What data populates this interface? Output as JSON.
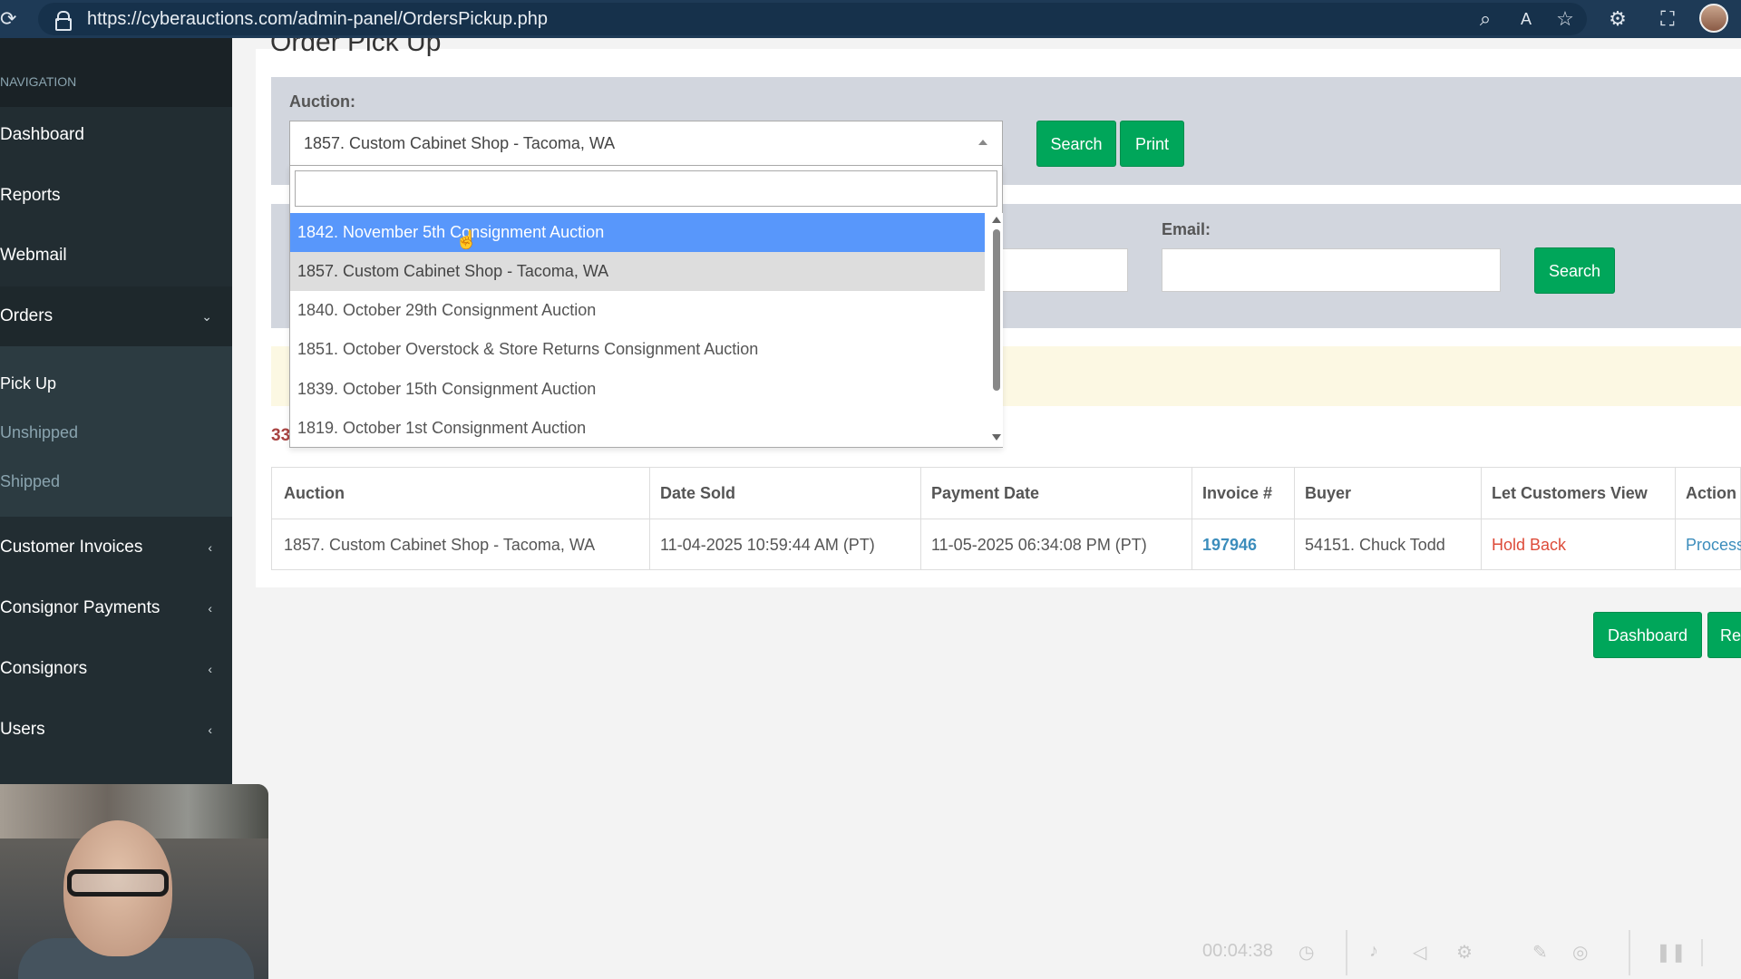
{
  "browser": {
    "url": "https://cyberauctions.com/admin-panel/OrdersPickup.php"
  },
  "sidebar": {
    "nav_header": "NAVIGATION",
    "items": [
      {
        "label": "Dashboard"
      },
      {
        "label": "Reports"
      },
      {
        "label": "Webmail"
      },
      {
        "label": "Orders"
      },
      {
        "label": "Customer Invoices"
      },
      {
        "label": "Consignor Payments"
      },
      {
        "label": "Consignors"
      },
      {
        "label": "Users"
      }
    ],
    "orders_sub": [
      {
        "label": "Pick Up",
        "active": true
      },
      {
        "label": "Unshipped"
      },
      {
        "label": "Shipped"
      }
    ]
  },
  "page": {
    "title": "Order Pick Up"
  },
  "auction_panel": {
    "label": "Auction:",
    "selected": "1857. Custom Cabinet Shop - Tacoma, WA",
    "search_button": "Search",
    "print_button": "Print"
  },
  "dropdown": {
    "search_value": "",
    "options": [
      "1842. November 5th Consignment Auction",
      "1857. Custom Cabinet Shop - Tacoma, WA",
      "1840. October 29th Consignment Auction",
      "1851. October Overstock & Store Returns Consignment Auction",
      "1839. October 15th Consignment Auction",
      "1819. October 1st Consignment Auction"
    ],
    "highlighted_index": 0,
    "selected_index": 1
  },
  "search_panel": {
    "email_label": "Email:",
    "email_value": "",
    "search_button": "Search"
  },
  "results": {
    "count_text": "33"
  },
  "table": {
    "headers": [
      "Auction",
      "Date Sold",
      "Payment Date",
      "Invoice #",
      "Buyer",
      "Let Customers View",
      "Action"
    ],
    "rows": [
      {
        "auction": "1857. Custom Cabinet Shop - Tacoma, WA",
        "date_sold": "11-04-2025 10:59:44 AM (PT)",
        "payment_date": "11-05-2025 06:34:08 PM (PT)",
        "invoice": "197946",
        "buyer": "54151. Chuck Todd",
        "let_view": "Hold Back",
        "action": "Process"
      }
    ]
  },
  "footer_buttons": {
    "dashboard": "Dashboard",
    "second": "Re"
  },
  "recorder": {
    "timer": "00:04:38"
  },
  "colors": {
    "sidebar": "#222d32",
    "button_green": "#00a65a",
    "highlight_blue": "#5897fb",
    "link_blue": "#3c8dbc",
    "danger_red": "#dd4b39",
    "browser_bar": "#1e3a56"
  }
}
